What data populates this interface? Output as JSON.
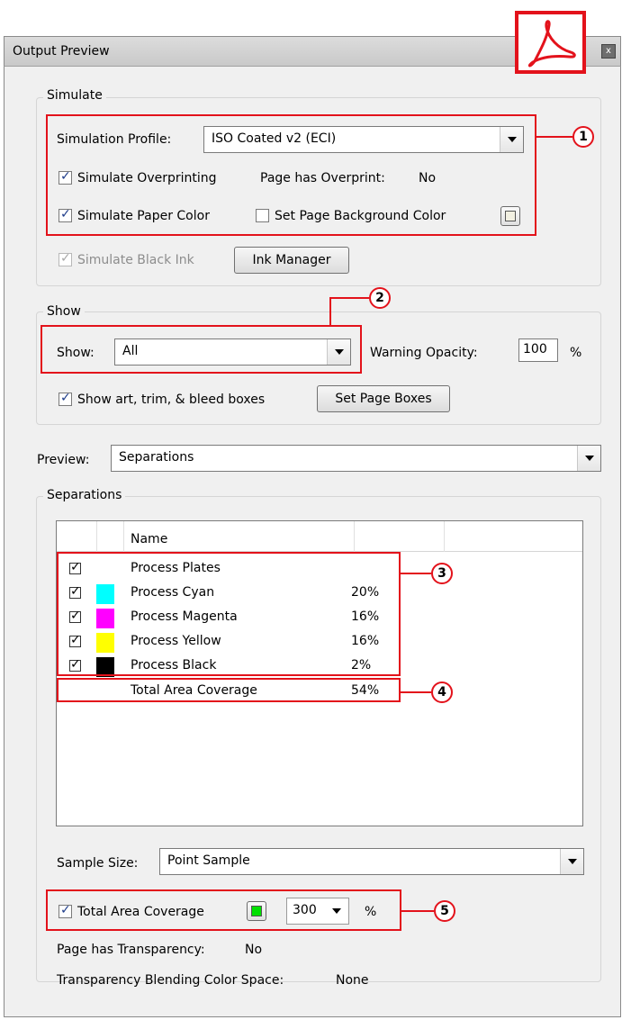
{
  "window": {
    "title": "Output Preview",
    "close_glyph": "x"
  },
  "simulate": {
    "label": "Simulate",
    "profile_label": "Simulation Profile:",
    "profile_value": "ISO Coated v2 (ECI)",
    "overprint_label": "Simulate Overprinting",
    "page_overprint_label": "Page has Overprint:",
    "page_overprint_value": "No",
    "paper_color_label": "Simulate Paper Color",
    "page_bg_label": "Set Page Background Color",
    "black_ink_label": "Simulate Black Ink",
    "ink_manager_label": "Ink Manager",
    "page_bg_swatch_color": "#f2f0e1"
  },
  "show": {
    "label": "Show",
    "show_label": "Show:",
    "show_value": "All",
    "warning_opacity_label": "Warning Opacity:",
    "warning_opacity_value": "100",
    "percent": "%",
    "boxes_label": "Show art, trim, & bleed boxes",
    "set_boxes_label": "Set Page Boxes"
  },
  "preview": {
    "label": "Preview:",
    "value": "Separations"
  },
  "separations": {
    "label": "Separations",
    "column_name": "Name",
    "rows": [
      {
        "name": "Process Plates",
        "pct": "",
        "color": ""
      },
      {
        "name": "Process Cyan",
        "pct": "20%",
        "color": "#00ffff"
      },
      {
        "name": "Process Magenta",
        "pct": "16%",
        "color": "#ff00ff"
      },
      {
        "name": "Process Yellow",
        "pct": "16%",
        "color": "#ffff00"
      },
      {
        "name": "Process Black",
        "pct": "2%",
        "color": "#000000"
      }
    ],
    "total_label": "Total Area Coverage",
    "total_pct": "54%"
  },
  "sample": {
    "label": "Sample Size:",
    "value": "Point Sample"
  },
  "tac": {
    "label": "Total Area Coverage",
    "value": "300",
    "percent": "%",
    "swatch_color": "#00e000"
  },
  "transparency": {
    "label": "Page has Transparency:",
    "value": "No",
    "blend_label": "Transparency Blending Color Space:",
    "blend_value": "None"
  },
  "callouts": [
    "1",
    "2",
    "3",
    "4",
    "5"
  ],
  "colors": {
    "accent_red": "#e3121b"
  }
}
